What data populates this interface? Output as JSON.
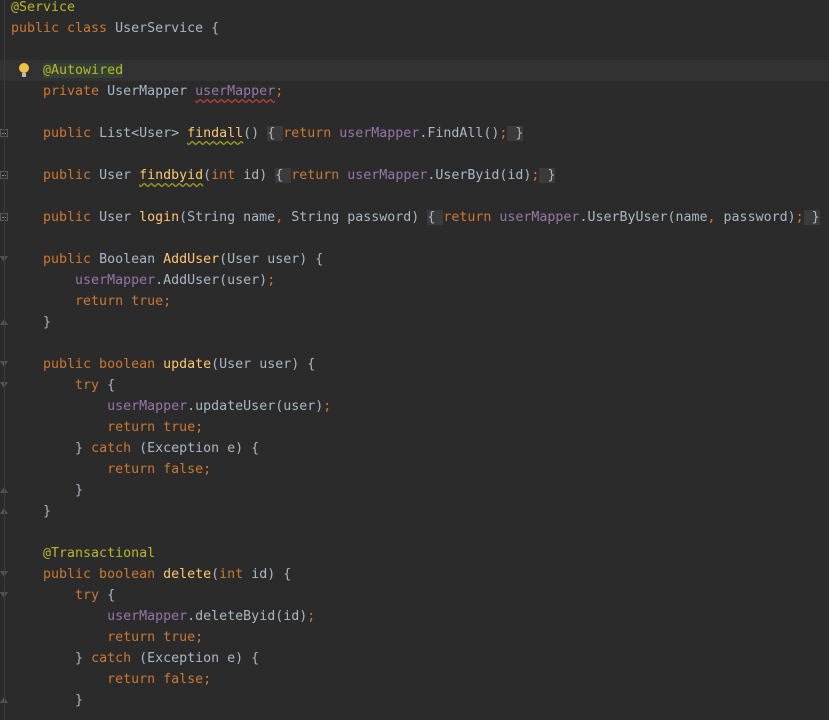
{
  "editor": {
    "colors": {
      "background": "#2b2b2b",
      "keyword": "#cc7832",
      "annotation": "#bbb529",
      "field": "#9876aa",
      "method": "#ffc66d",
      "text": "#a9b7c6"
    },
    "lines": [
      {
        "tokens": [
          {
            "t": "@Service",
            "c": "ann"
          }
        ]
      },
      {
        "tokens": [
          {
            "t": "public class ",
            "c": "kw"
          },
          {
            "t": "UserService {",
            "c": "txt"
          }
        ]
      },
      {
        "tokens": []
      },
      {
        "current": true,
        "icon": "lightbulb-icon",
        "tokens": [
          {
            "t": "    ",
            "c": "txt"
          },
          {
            "t": "@Autowired",
            "c": "ann annbg"
          }
        ]
      },
      {
        "tokens": [
          {
            "t": "    private ",
            "c": "kw"
          },
          {
            "t": "UserMapper ",
            "c": "txt"
          },
          {
            "t": "userMapper",
            "c": "fld squiggle"
          },
          {
            "t": ";",
            "c": "kw"
          }
        ]
      },
      {
        "tokens": []
      },
      {
        "fold": "plus",
        "tokens": [
          {
            "t": "    public ",
            "c": "kw"
          },
          {
            "t": "List<User> ",
            "c": "txt"
          },
          {
            "t": "findall",
            "c": "fn squiggle-y"
          },
          {
            "t": "() ",
            "c": "txt"
          },
          {
            "t": "{ ",
            "c": "fold"
          },
          {
            "t": "return ",
            "c": "kw"
          },
          {
            "t": "userMapper",
            "c": "fld"
          },
          {
            "t": ".FindAll()",
            "c": "txt"
          },
          {
            "t": ";",
            "c": "kw"
          },
          {
            "t": " }",
            "c": "fold"
          }
        ]
      },
      {
        "tokens": []
      },
      {
        "fold": "plus",
        "tokens": [
          {
            "t": "    public ",
            "c": "kw"
          },
          {
            "t": "User ",
            "c": "txt"
          },
          {
            "t": "findbyid",
            "c": "fn squiggle-y"
          },
          {
            "t": "(",
            "c": "txt"
          },
          {
            "t": "int ",
            "c": "kw"
          },
          {
            "t": "id) ",
            "c": "txt"
          },
          {
            "t": "{ ",
            "c": "fold"
          },
          {
            "t": "return ",
            "c": "kw"
          },
          {
            "t": "userMapper",
            "c": "fld"
          },
          {
            "t": ".UserByid(id)",
            "c": "txt"
          },
          {
            "t": ";",
            "c": "kw"
          },
          {
            "t": " }",
            "c": "fold"
          }
        ]
      },
      {
        "tokens": []
      },
      {
        "fold": "plus",
        "tokens": [
          {
            "t": "    public ",
            "c": "kw"
          },
          {
            "t": "User ",
            "c": "txt"
          },
          {
            "t": "login",
            "c": "fn"
          },
          {
            "t": "(String name",
            "c": "txt"
          },
          {
            "t": ", ",
            "c": "kw"
          },
          {
            "t": "String password) ",
            "c": "txt"
          },
          {
            "t": "{ ",
            "c": "fold"
          },
          {
            "t": "return ",
            "c": "kw"
          },
          {
            "t": "userMapper",
            "c": "fld"
          },
          {
            "t": ".UserByUser(name",
            "c": "txt"
          },
          {
            "t": ", ",
            "c": "kw"
          },
          {
            "t": "password)",
            "c": "txt"
          },
          {
            "t": ";",
            "c": "kw"
          },
          {
            "t": " }",
            "c": "fold"
          }
        ]
      },
      {
        "tokens": []
      },
      {
        "fold": "open",
        "tokens": [
          {
            "t": "    public ",
            "c": "kw"
          },
          {
            "t": "Boolean ",
            "c": "txt"
          },
          {
            "t": "AddUser",
            "c": "fn"
          },
          {
            "t": "(User user) {",
            "c": "txt"
          }
        ]
      },
      {
        "tokens": [
          {
            "t": "        ",
            "c": "txt"
          },
          {
            "t": "userMapper",
            "c": "fld"
          },
          {
            "t": ".AddUser(user)",
            "c": "txt"
          },
          {
            "t": ";",
            "c": "kw"
          }
        ]
      },
      {
        "tokens": [
          {
            "t": "        return true;",
            "c": "kw"
          }
        ]
      },
      {
        "fold": "close",
        "tokens": [
          {
            "t": "    }",
            "c": "txt"
          }
        ]
      },
      {
        "tokens": []
      },
      {
        "fold": "open",
        "tokens": [
          {
            "t": "    public boolean ",
            "c": "kw"
          },
          {
            "t": "update",
            "c": "fn"
          },
          {
            "t": "(User user) {",
            "c": "txt"
          }
        ]
      },
      {
        "fold": "open",
        "tokens": [
          {
            "t": "        try ",
            "c": "kw"
          },
          {
            "t": "{",
            "c": "txt"
          }
        ]
      },
      {
        "tokens": [
          {
            "t": "            ",
            "c": "txt"
          },
          {
            "t": "userMapper",
            "c": "fld"
          },
          {
            "t": ".updateUser(user)",
            "c": "txt"
          },
          {
            "t": ";",
            "c": "kw"
          }
        ]
      },
      {
        "tokens": [
          {
            "t": "            return true;",
            "c": "kw"
          }
        ]
      },
      {
        "tokens": [
          {
            "t": "        } ",
            "c": "txt"
          },
          {
            "t": "catch ",
            "c": "kw"
          },
          {
            "t": "(Exception e) {",
            "c": "txt"
          }
        ]
      },
      {
        "tokens": [
          {
            "t": "            return false;",
            "c": "kw"
          }
        ]
      },
      {
        "fold": "close",
        "tokens": [
          {
            "t": "        }",
            "c": "txt"
          }
        ]
      },
      {
        "fold": "close",
        "tokens": [
          {
            "t": "    }",
            "c": "txt"
          }
        ]
      },
      {
        "tokens": []
      },
      {
        "tokens": [
          {
            "t": "    @Transactional",
            "c": "ann"
          }
        ]
      },
      {
        "fold": "open",
        "tokens": [
          {
            "t": "    public boolean ",
            "c": "kw"
          },
          {
            "t": "delete",
            "c": "fn"
          },
          {
            "t": "(",
            "c": "txt"
          },
          {
            "t": "int ",
            "c": "kw"
          },
          {
            "t": "id) {",
            "c": "txt"
          }
        ]
      },
      {
        "fold": "open",
        "tokens": [
          {
            "t": "        try ",
            "c": "kw"
          },
          {
            "t": "{",
            "c": "txt"
          }
        ]
      },
      {
        "tokens": [
          {
            "t": "            ",
            "c": "txt"
          },
          {
            "t": "userMapper",
            "c": "fld"
          },
          {
            "t": ".deleteByid(id)",
            "c": "txt"
          },
          {
            "t": ";",
            "c": "kw"
          }
        ]
      },
      {
        "tokens": [
          {
            "t": "            return true;",
            "c": "kw"
          }
        ]
      },
      {
        "tokens": [
          {
            "t": "        } ",
            "c": "txt"
          },
          {
            "t": "catch ",
            "c": "kw"
          },
          {
            "t": "(Exception e) {",
            "c": "txt"
          }
        ]
      },
      {
        "tokens": [
          {
            "t": "            return false;",
            "c": "kw"
          }
        ]
      },
      {
        "fold": "close",
        "tokens": [
          {
            "t": "        }",
            "c": "txt"
          }
        ]
      }
    ]
  }
}
